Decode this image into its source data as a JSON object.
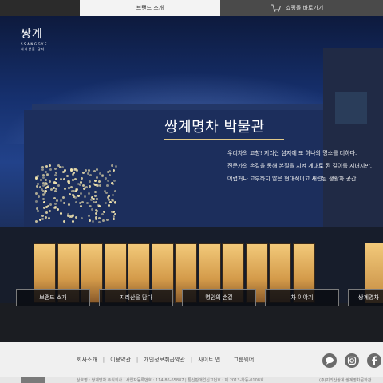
{
  "topbar": {
    "brand_tab": "브랜드 소개",
    "shop_tab": "쇼핑몰 바로가기",
    "cart_icon": "shopping-cart-icon"
  },
  "logo": {
    "main": "쌍계",
    "sub": "SSANGGYE",
    "kr": "지리산을 담다"
  },
  "hero": {
    "title": "쌍계명차 박물관",
    "desc": [
      "우리차의 고향! 지리산 섬지에 또 하나의 명소를 더하다.",
      "전문가의 손길을 통해 본질을 지켜 계대로 된 깊이를 지녀지만,",
      "어렵거나 고루하지 않은 현대적이고 새련된 생활차 공간"
    ]
  },
  "menu": [
    "브랜드 소개",
    "지리산을 담다",
    "명인의 손길",
    "차 이야기",
    "쌍계명차"
  ],
  "footer": {
    "links": [
      "회사소개",
      "이용약관",
      "개인정보취급약관",
      "사이트 맵",
      "그룹웨어"
    ],
    "social": [
      "chat-icon",
      "instagram-icon",
      "facebook-icon"
    ],
    "bottom_text": "상호명 : 쌍계명차 주식회사  |  사업자등록번호 : 114-86-65887  |  통신판매업신고번호 : 제 2013-하동-0108호",
    "bottom_right": "(주)지리산쌍계 쌍계명차문화관"
  },
  "colors": {
    "accent": "#e0c98a",
    "topbar": "#2b2b2b",
    "footer": "#f0f0f0"
  }
}
